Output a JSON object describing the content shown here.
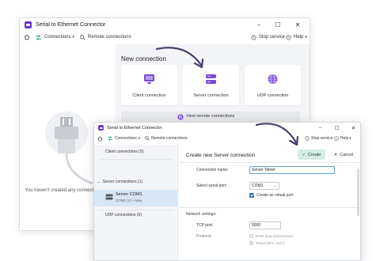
{
  "back_window": {
    "title": "Serial to Ethernet Connector",
    "controls": {
      "minimize": "–",
      "maximize": "☐",
      "close": "✕"
    },
    "toolbar": {
      "connections": "Connections",
      "remote": "Remote connections",
      "stop_service": "Stop service",
      "help": "Help"
    },
    "empty_message": "You haven't created any connections yet.",
    "new_connection": {
      "heading": "New connection",
      "cards": [
        {
          "label": "Client connection",
          "icon": "monitor-icon"
        },
        {
          "label": "Server connection",
          "icon": "server-icon"
        },
        {
          "label": "UDP connection",
          "icon": "globe-icon"
        }
      ],
      "view_remote": "View remote connections"
    }
  },
  "front_window": {
    "title": "Serial to Ethernet Connector",
    "controls": {
      "minimize": "–",
      "maximize": "☐",
      "close": "✕"
    },
    "toolbar": {
      "connections": "Connections",
      "remote": "Remote connections",
      "stop_service": "Stop service",
      "help": "Help"
    },
    "sidebar": {
      "client": "Client connections (0)",
      "server": "Server connections (1)",
      "selected": {
        "name": "Server COM1",
        "sub": "COM1 (V) • New"
      },
      "udp": "UDP connections (0)"
    },
    "form": {
      "title": "Create new Server connection",
      "create_button": "Create",
      "cancel_button": "Cancel",
      "name_label": "Connection name:",
      "name_value": "Server Telnet",
      "port_label": "Select serial port:",
      "port_value": "COM1",
      "virtual_port_label": "Create as virtual port",
      "virtual_port_checked": true,
      "network_heading": "Network settings:",
      "tcp_label": "TCP port:",
      "tcp_value": "5000",
      "protocol_label": "Protocol:",
      "protocol_options": [
        "RAW data transmission",
        "Telnet (RFC 2217)"
      ],
      "protocol_selected": "Telnet (RFC 2217)"
    }
  },
  "colors": {
    "accent_purple": "#6b35c9",
    "create_button_bg": "#d6ebe4",
    "selected_row": "#d7e6f7",
    "checkbox_blue": "#2f6db6"
  }
}
